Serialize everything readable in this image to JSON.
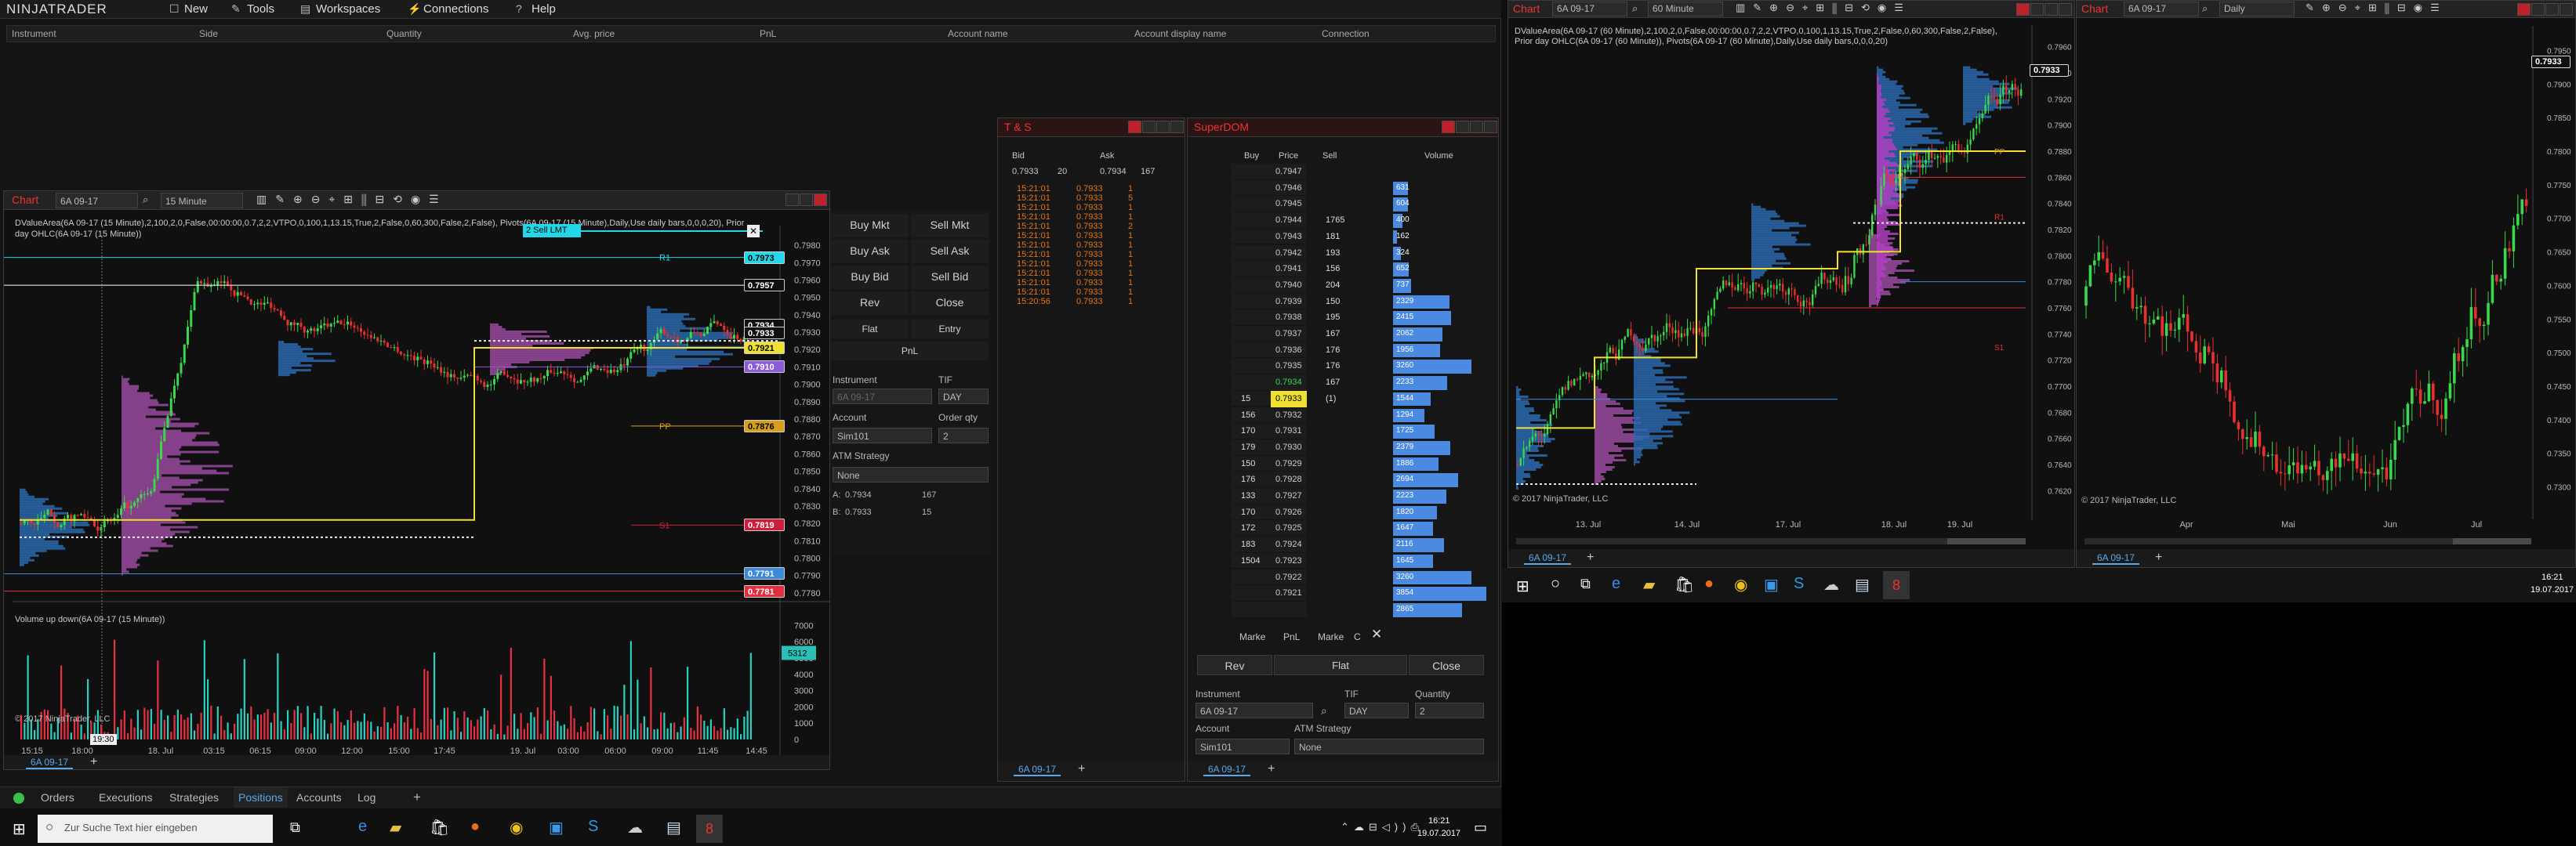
{
  "app": {
    "logo": "NINJATRADER",
    "menu": [
      "New",
      "Tools",
      "Workspaces",
      "Connections",
      "Help"
    ]
  },
  "positions": {
    "columns": [
      "Instrument",
      "Side",
      "Quantity",
      "Avg. price",
      "PnL",
      "Account name",
      "Account display name",
      "Connection"
    ]
  },
  "chart1": {
    "title": "Chart",
    "instrument": "6A 09-17",
    "interval": "15 Minute",
    "indicator_text": "DValueArea(6A 09-17 (15 Minute),2,100,2,0,False,00:00:00,0.7,2,2,VTPO,0,100,1,13.15,True,2,False,0,60,300,False,2,False), Pivots(6A 09-17 (15 Minute),Daily,Use daily bars,0,0,0,20), Prior day OHLC(6A 09-17 (15 Minute))",
    "sell_lmt": "2  Sell LMT",
    "labels": {
      "r1": "R1",
      "pp": "PP",
      "s1": "S1"
    },
    "price_ticks": [
      "0.7980",
      "0.7970",
      "0.7960",
      "0.7950",
      "0.7940",
      "0.7930",
      "0.7920",
      "0.7910",
      "0.7900",
      "0.7890",
      "0.7880",
      "0.7870",
      "0.7860",
      "0.7850",
      "0.7840",
      "0.7830",
      "0.7820",
      "0.7810",
      "0.7800",
      "0.7790",
      "0.7780"
    ],
    "price_boxes": [
      {
        "v": "0.7973",
        "bg": "#22d8e8",
        "fg": "#000"
      },
      {
        "v": "0.7957",
        "bg": "#101010",
        "fg": "#fff"
      },
      {
        "v": "0.7934",
        "bg": "#101010",
        "fg": "#fff"
      },
      {
        "v": "0.7933",
        "bg": "#101010",
        "fg": "#fff"
      },
      {
        "v": "0.7921",
        "bg": "#f0e030",
        "fg": "#000"
      },
      {
        "v": "0.7910",
        "bg": "#8a5ad8",
        "fg": "#fff"
      },
      {
        "v": "0.7876",
        "bg": "#d8a018",
        "fg": "#000"
      },
      {
        "v": "0.7819",
        "bg": "#d01c3c",
        "fg": "#fff"
      },
      {
        "v": "0.7791",
        "bg": "#3a8ad8",
        "fg": "#fff"
      },
      {
        "v": "0.7781",
        "bg": "#e03040",
        "fg": "#fff"
      }
    ],
    "volume_title": "Volume up down(6A 09-17 (15 Minute))",
    "volume_ticks": [
      "7000",
      "6000",
      "5312",
      "5000",
      "4000",
      "3000",
      "2000",
      "1000",
      "0"
    ],
    "time_ticks": [
      "15:15",
      "18:00",
      "18. Jul",
      "03:15",
      "06:15",
      "09:00",
      "12:00",
      "15:00",
      "17:45",
      "19. Jul",
      "03:00",
      "06:00",
      "09:00",
      "11:45",
      "14:45"
    ],
    "crosshair_time": "19:30",
    "copyright": "© 2017 NinjaTrader, LLC",
    "tab": "6A 09-17"
  },
  "chart_trader": {
    "buy_mkt": "Buy Mkt",
    "sell_mkt": "Sell Mkt",
    "buy_ask": "Buy Ask",
    "sell_ask": "Sell Ask",
    "buy_bid": "Buy Bid",
    "sell_bid": "Sell Bid",
    "rev": "Rev",
    "close": "Close",
    "flat": "Flat",
    "entry": "Entry",
    "pnl": "PnL",
    "instrument_lbl": "Instrument",
    "instrument": "6A 09-17",
    "tif_lbl": "TIF",
    "tif": "DAY",
    "account_lbl": "Account",
    "account": "Sim101",
    "qty_lbl": "Order qty",
    "qty": "2",
    "atm_lbl": "ATM Strategy",
    "atm": "None",
    "ask_lbl": "A:",
    "ask": "0.7934",
    "ask_size": "167",
    "bid_lbl": "B:",
    "bid": "0.7933",
    "bid_size": "15"
  },
  "ts": {
    "title": "T & S",
    "headers": [
      "Bid",
      "Ask"
    ],
    "bid": "0.7933",
    "bid_size": "20",
    "ask": "0.7934",
    "ask_size": "167",
    "rows": [
      {
        "t": "15:21:01",
        "p": "0.7933",
        "q": "1"
      },
      {
        "t": "15:21:01",
        "p": "0.7933",
        "q": "5"
      },
      {
        "t": "15:21:01",
        "p": "0.7933",
        "q": "1"
      },
      {
        "t": "15:21:01",
        "p": "0.7933",
        "q": "1"
      },
      {
        "t": "15:21:01",
        "p": "0.7933",
        "q": "2"
      },
      {
        "t": "15:21:01",
        "p": "0.7933",
        "q": "1"
      },
      {
        "t": "15:21:01",
        "p": "0.7933",
        "q": "1"
      },
      {
        "t": "15:21:01",
        "p": "0.7933",
        "q": "1"
      },
      {
        "t": "15:21:01",
        "p": "0.7933",
        "q": "1"
      },
      {
        "t": "15:21:01",
        "p": "0.7933",
        "q": "1"
      },
      {
        "t": "15:21:01",
        "p": "0.7933",
        "q": "1"
      },
      {
        "t": "15:21:01",
        "p": "0.7933",
        "q": "1"
      },
      {
        "t": "15:20:56",
        "p": "0.7933",
        "q": "1"
      }
    ],
    "tab": "6A 09-17"
  },
  "superdom": {
    "title": "SuperDOM",
    "headers": [
      "Buy",
      "Price",
      "Sell",
      "Volume"
    ],
    "rows": [
      {
        "buy": "",
        "price": "0.7947",
        "sell": "",
        "vol": ""
      },
      {
        "buy": "",
        "price": "0.7946",
        "sell": "",
        "vol": "631"
      },
      {
        "buy": "",
        "price": "0.7945",
        "sell": "",
        "vol": "604"
      },
      {
        "buy": "",
        "price": "0.7944",
        "sell": "1765",
        "vol": "400"
      },
      {
        "buy": "",
        "price": "0.7943",
        "sell": "181",
        "vol": "162"
      },
      {
        "buy": "",
        "price": "0.7942",
        "sell": "193",
        "vol": "324"
      },
      {
        "buy": "",
        "price": "0.7941",
        "sell": "156",
        "vol": "652"
      },
      {
        "buy": "",
        "price": "0.7940",
        "sell": "204",
        "vol": "737"
      },
      {
        "buy": "",
        "price": "0.7939",
        "sell": "150",
        "vol": "2329"
      },
      {
        "buy": "",
        "price": "0.7938",
        "sell": "195",
        "vol": "2415"
      },
      {
        "buy": "",
        "price": "0.7937",
        "sell": "167",
        "vol": "2062"
      },
      {
        "buy": "",
        "price": "0.7936",
        "sell": "176",
        "vol": "1956"
      },
      {
        "buy": "",
        "price": "0.7935",
        "sell": "176",
        "vol": "3260"
      },
      {
        "buy": "",
        "price": "0.7934",
        "sell": "167",
        "vol": "2233"
      },
      {
        "buy": "15",
        "price": "0.7933",
        "sell": "(1)",
        "vol": "1544"
      },
      {
        "buy": "156",
        "price": "0.7932",
        "sell": "",
        "vol": "1294"
      },
      {
        "buy": "170",
        "price": "0.7931",
        "sell": "",
        "vol": "1725"
      },
      {
        "buy": "179",
        "price": "0.7930",
        "sell": "",
        "vol": "2379"
      },
      {
        "buy": "150",
        "price": "0.7929",
        "sell": "",
        "vol": "1886"
      },
      {
        "buy": "176",
        "price": "0.7928",
        "sell": "",
        "vol": "2694"
      },
      {
        "buy": "133",
        "price": "0.7927",
        "sell": "",
        "vol": "2223"
      },
      {
        "buy": "170",
        "price": "0.7926",
        "sell": "",
        "vol": "1820"
      },
      {
        "buy": "172",
        "price": "0.7925",
        "sell": "",
        "vol": "1647"
      },
      {
        "buy": "183",
        "price": "0.7924",
        "sell": "",
        "vol": "2116"
      },
      {
        "buy": "1504",
        "price": "0.7923",
        "sell": "",
        "vol": "1645"
      },
      {
        "buy": "",
        "price": "0.7922",
        "sell": "",
        "vol": "3260"
      },
      {
        "buy": "",
        "price": "0.7921",
        "sell": "",
        "vol": "3854"
      },
      {
        "buy": "",
        "price": "",
        "sell": "",
        "vol": "2865"
      }
    ],
    "market_l": "Marke",
    "pnl": "PnL",
    "market_r": "Marke",
    "c": "C",
    "rev": "Rev",
    "flat": "Flat",
    "close": "Close",
    "instrument_lbl": "Instrument",
    "instrument": "6A 09-17",
    "tif_lbl": "TIF",
    "tif": "DAY",
    "qty_lbl": "Quantity",
    "qty": "2",
    "account_lbl": "Account",
    "account": "Sim101",
    "atm_lbl": "ATM Strategy",
    "atm": "None",
    "tab": "6A 09-17"
  },
  "chart2": {
    "title": "Chart",
    "instrument": "6A 09-17",
    "interval": "60 Minute",
    "indicator_text": "DValueArea(6A 09-17 (60 Minute),2,100,2,0,False,00:00:00,0.7,2,2,VTPO,0,100,1,13.15,True,2,False,0,60,300,False,2,False), Prior day OHLC(6A 09-17 (60 Minute)), Pivots(6A 09-17 (60 Minute),Daily,Use daily bars,0,0,0,20)",
    "price_ticks": [
      "0.7960",
      "0.7940",
      "0.7920",
      "0.7900",
      "0.7880",
      "0.7860",
      "0.7840",
      "0.7820",
      "0.7800",
      "0.7780",
      "0.7760",
      "0.7740",
      "0.7720",
      "0.7700",
      "0.7680",
      "0.7660",
      "0.7640",
      "0.7620"
    ],
    "price_boxes": [
      "0.7933"
    ],
    "labels": {
      "pp": "PP",
      "r1": "R1",
      "s1": "S1"
    },
    "time_ticks": [
      "13. Jul",
      "14. Jul",
      "17. Jul",
      "18. Jul",
      "19. Jul"
    ],
    "copyright": "© 2017 NinjaTrader, LLC",
    "tab": "6A 09-17"
  },
  "chart3": {
    "title": "Chart",
    "instrument": "6A 09-17",
    "interval": "Daily",
    "price_ticks": [
      "0.7950",
      "0.7900",
      "0.7850",
      "0.7800",
      "0.7750",
      "0.7700",
      "0.7650",
      "0.7600",
      "0.7550",
      "0.7500",
      "0.7450",
      "0.7400",
      "0.7350",
      "0.7300"
    ],
    "price_box": "0.7933",
    "time_ticks": [
      "Apr",
      "Mai",
      "Jun",
      "Jul"
    ],
    "copyright": "© 2017 NinjaTrader, LLC",
    "tab": "6A 09-17"
  },
  "control_center_tabs": [
    "Orders",
    "Executions",
    "Strategies",
    "Positions",
    "Accounts",
    "Log"
  ],
  "active_tab": "Positions",
  "taskbar": {
    "search": "Zur Suche Text hier eingeben",
    "time": "16:21",
    "date": "19.07.2017"
  }
}
